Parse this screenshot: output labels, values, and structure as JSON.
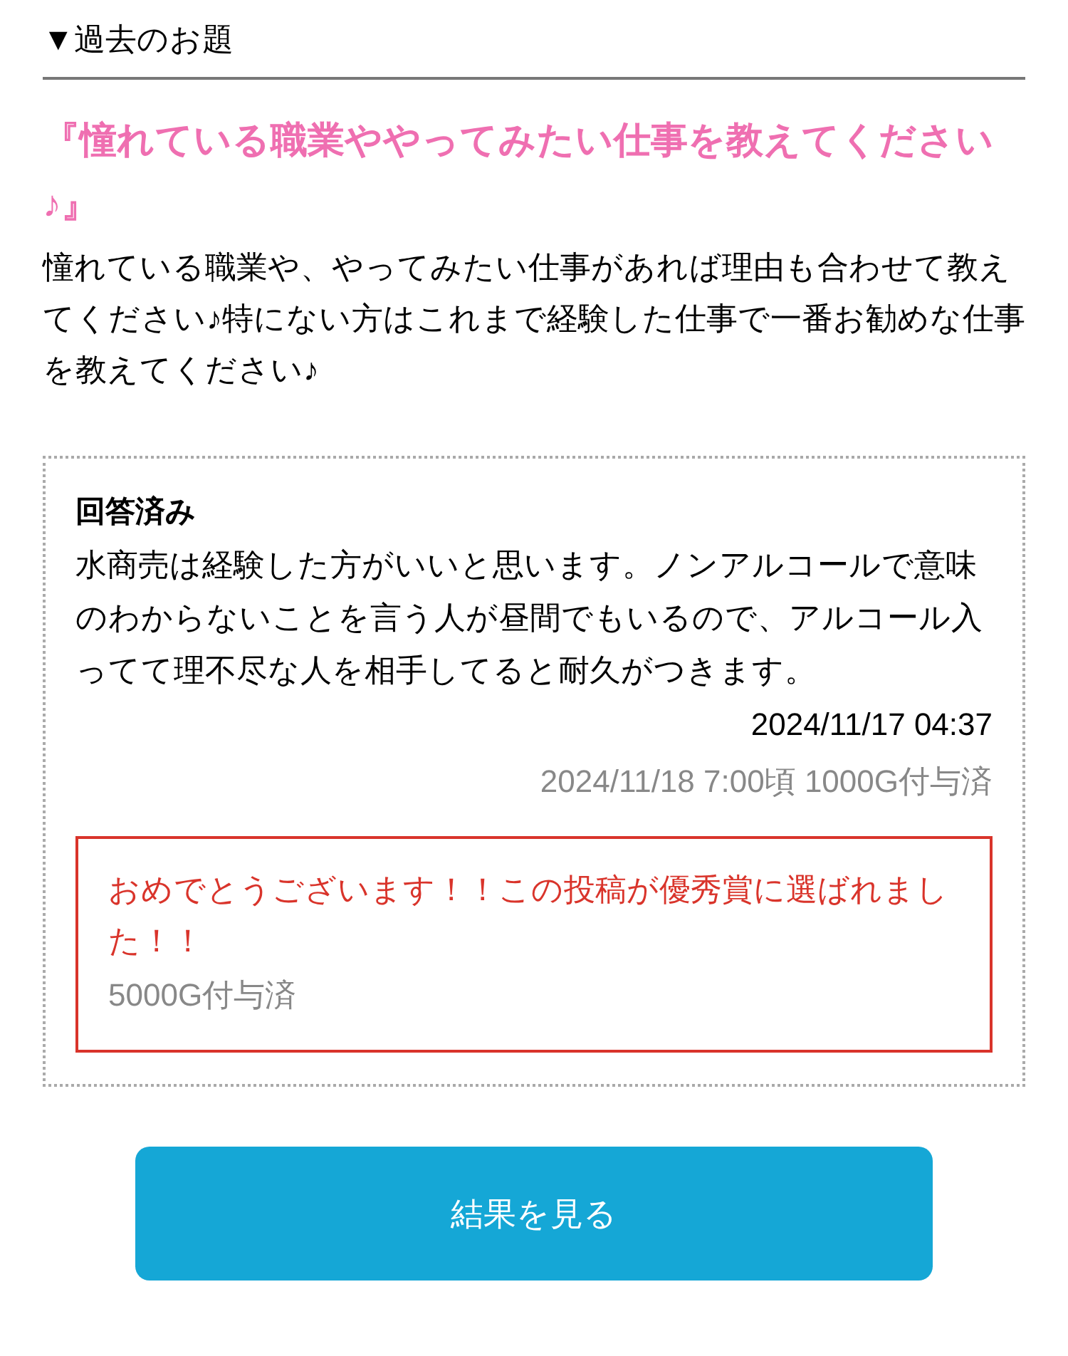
{
  "section_heading": "▼過去のお題",
  "topic": {
    "title": "『憧れている職業ややってみたい仕事を教えてください♪』",
    "description": "憧れている職業や、やってみたい仕事があれば理由も合わせて教えてください♪特にない方はこれまで経験した仕事で一番お勧めな仕事を教えてください♪"
  },
  "answer": {
    "status": "回答済み",
    "text": "水商売は経験した方がいいと思います。ノンアルコールで意味のわからないことを言う人が昼間でもいるので、アルコール入ってて理不尽な人を相手してると耐久がつきます。",
    "posted_at": "2024/11/17 04:37",
    "reward_note": "2024/11/18 7:00頃 1000G付与済",
    "award": {
      "message": "おめでとうございます！！この投稿が優秀賞に選ばれました！！",
      "reward": "5000G付与済"
    }
  },
  "button": {
    "label": "結果を見る"
  }
}
